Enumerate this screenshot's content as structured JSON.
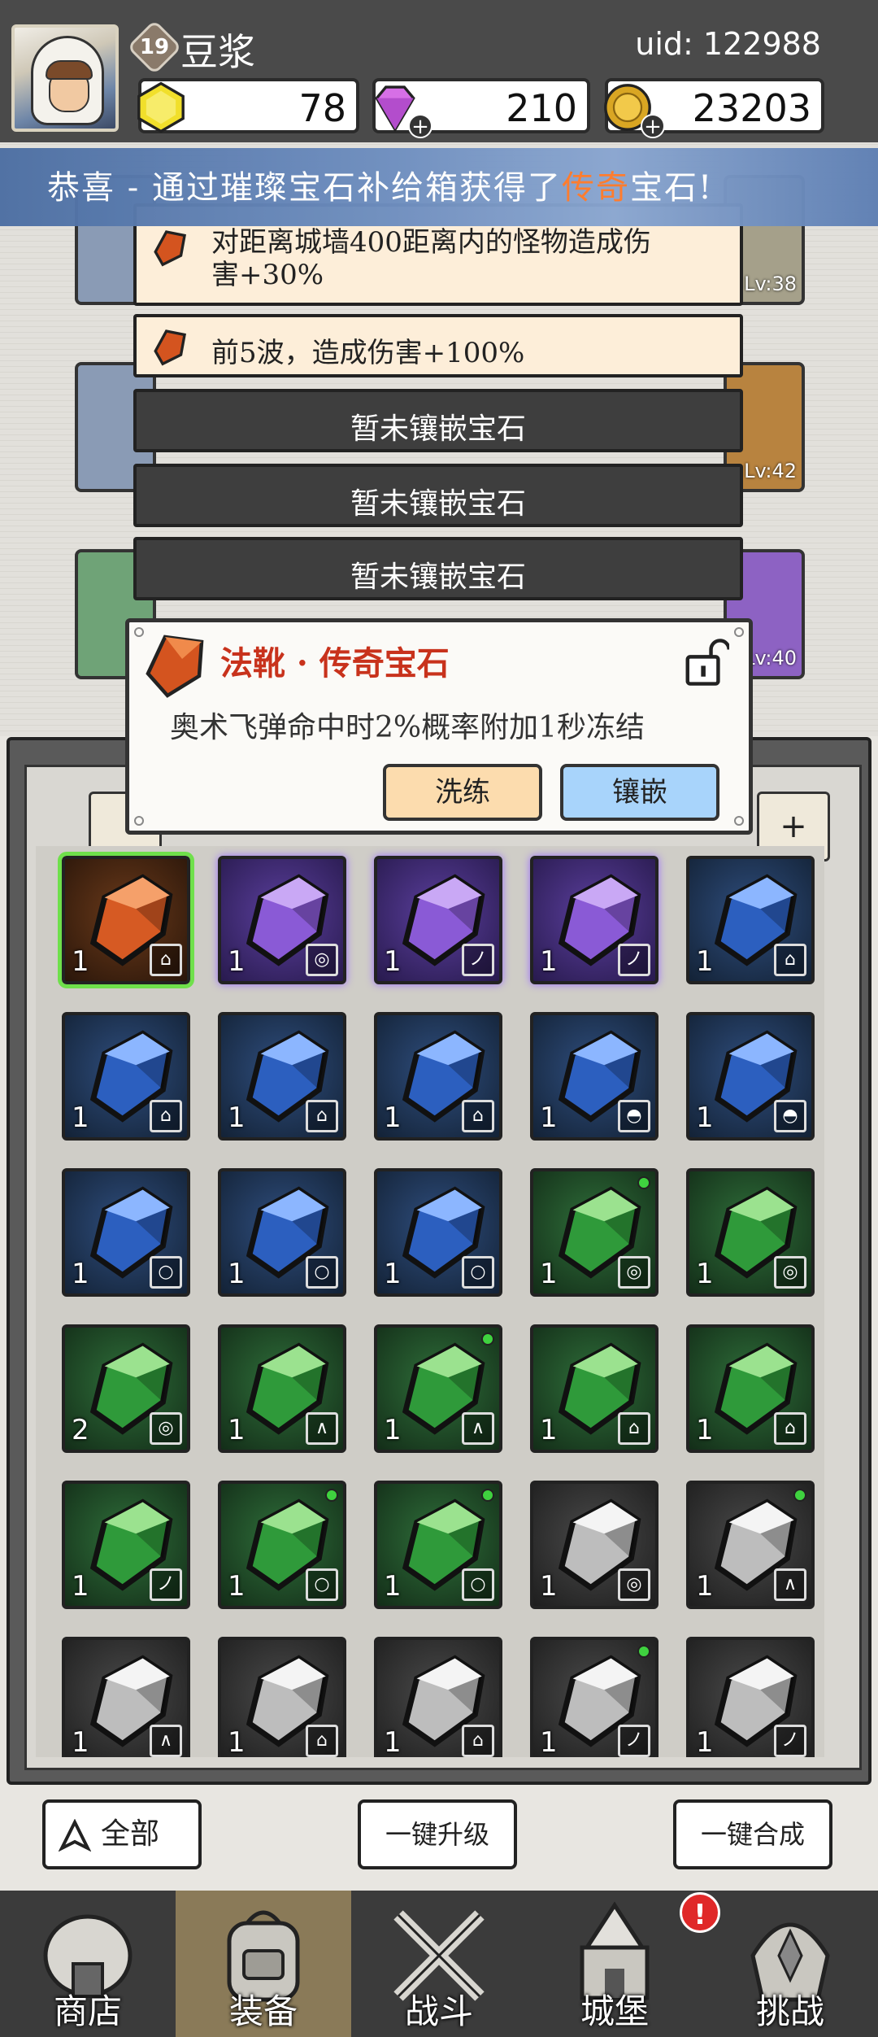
{
  "player": {
    "level": "19",
    "name": "豆浆",
    "uid": "uid: 122988"
  },
  "currency": {
    "gold": "78",
    "gems": "210",
    "coins": "23203"
  },
  "banner": {
    "prefix": "恭喜 - 通过璀璨宝石补给箱获得了",
    "highlight": "传奇",
    "suffix": "宝石!"
  },
  "sockets": [
    {
      "text_line1": "对距离城墙400距离内的怪物造成伤",
      "text_line2": "害+30%"
    },
    {
      "text_line1": "前5波，造成伤害+100%",
      "text_line2": ""
    },
    {
      "text_line1": "暂未镶嵌宝石"
    },
    {
      "text_line1": "暂未镶嵌宝石"
    },
    {
      "text_line1": "暂未镶嵌宝石"
    }
  ],
  "popup": {
    "title": "法靴 · 传奇宝石",
    "description": "奥术飞弹命中时2%概率附加1秒冻结",
    "wash_label": "洗练",
    "embed_label": "镶嵌"
  },
  "slot_levels": {
    "l1": "Lv:38",
    "l2": "Lv:42",
    "l3": "Lv:40"
  },
  "inventory": [
    {
      "color": "orange",
      "count": "1",
      "type": "boot-icon",
      "dot": false,
      "selected": true
    },
    {
      "color": "purple",
      "count": "1",
      "type": "ring-icon",
      "dot": false
    },
    {
      "color": "purple",
      "count": "1",
      "type": "wand-icon",
      "dot": false
    },
    {
      "color": "purple",
      "count": "1",
      "type": "wand-icon",
      "dot": false
    },
    {
      "color": "blue",
      "count": "1",
      "type": "boot-icon",
      "dot": false
    },
    {
      "color": "blue",
      "count": "1",
      "type": "boot-icon",
      "dot": false
    },
    {
      "color": "blue",
      "count": "1",
      "type": "boot-icon",
      "dot": false
    },
    {
      "color": "blue",
      "count": "1",
      "type": "boot-icon",
      "dot": false
    },
    {
      "color": "blue",
      "count": "1",
      "type": "hat-icon",
      "dot": false
    },
    {
      "color": "blue",
      "count": "1",
      "type": "hat-icon",
      "dot": false
    },
    {
      "color": "blue",
      "count": "1",
      "type": "necklace-icon",
      "dot": false
    },
    {
      "color": "blue",
      "count": "1",
      "type": "necklace-icon",
      "dot": false
    },
    {
      "color": "blue",
      "count": "1",
      "type": "necklace-icon",
      "dot": false
    },
    {
      "color": "green",
      "count": "1",
      "type": "ring-icon",
      "dot": true
    },
    {
      "color": "green",
      "count": "1",
      "type": "ring-icon",
      "dot": false
    },
    {
      "color": "green",
      "count": "2",
      "type": "ring-icon",
      "dot": false
    },
    {
      "color": "green",
      "count": "1",
      "type": "robe-icon",
      "dot": false
    },
    {
      "color": "green",
      "count": "1",
      "type": "robe-icon",
      "dot": true
    },
    {
      "color": "green",
      "count": "1",
      "type": "boot-icon",
      "dot": false
    },
    {
      "color": "green",
      "count": "1",
      "type": "boot-icon",
      "dot": false
    },
    {
      "color": "green",
      "count": "1",
      "type": "wand-icon",
      "dot": false
    },
    {
      "color": "green",
      "count": "1",
      "type": "necklace-icon",
      "dot": true
    },
    {
      "color": "green",
      "count": "1",
      "type": "necklace-icon",
      "dot": true
    },
    {
      "color": "white",
      "count": "1",
      "type": "ring-icon",
      "dot": false
    },
    {
      "color": "white",
      "count": "1",
      "type": "robe-icon",
      "dot": true
    },
    {
      "color": "white",
      "count": "1",
      "type": "robe-icon",
      "dot": false
    },
    {
      "color": "white",
      "count": "1",
      "type": "boot-icon",
      "dot": false
    },
    {
      "color": "white",
      "count": "1",
      "type": "boot-icon",
      "dot": false
    },
    {
      "color": "white",
      "count": "1",
      "type": "wand-icon",
      "dot": true
    },
    {
      "color": "white",
      "count": "1",
      "type": "wand-icon",
      "dot": false
    }
  ],
  "actions": {
    "filter": "全部",
    "upgrade": "一键升级",
    "merge": "一键合成"
  },
  "nav": [
    {
      "label": "商店",
      "icon": "shop-icon"
    },
    {
      "label": "装备",
      "icon": "backpack-icon"
    },
    {
      "label": "战斗",
      "icon": "swords-icon"
    },
    {
      "label": "城堡",
      "icon": "castle-icon"
    },
    {
      "label": "挑战",
      "icon": "helmet-icon"
    }
  ],
  "nav_alert": "!"
}
